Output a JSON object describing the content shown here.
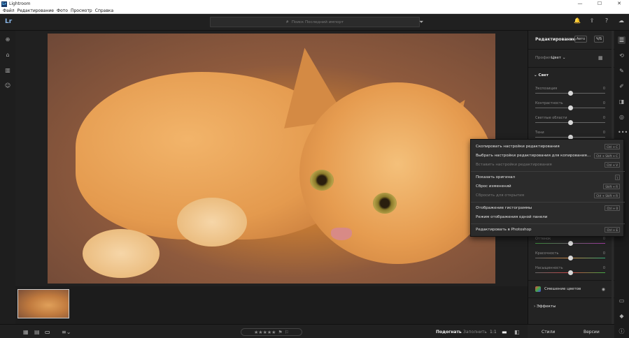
{
  "window": {
    "title": "Lightroom"
  },
  "menu": {
    "items": [
      "Файл",
      "Редактирование",
      "Фото",
      "Просмотр",
      "Справка"
    ]
  },
  "app": {
    "logo": "Lr"
  },
  "search": {
    "placeholder": "Поиск Последний импорт"
  },
  "edit_panel": {
    "title": "Редактирование",
    "auto": "Авто",
    "bw": "Ч/Б",
    "profile_label": "Профиль",
    "profile_value": "Цвет",
    "light_section": "Свет",
    "sliders": [
      {
        "label": "Экспозиция",
        "value": "0",
        "position": 0.5
      },
      {
        "label": "Контрастность",
        "value": "0",
        "position": 0.5
      },
      {
        "label": "Светлые области",
        "value": "0",
        "position": 0.5
      },
      {
        "label": "Тени",
        "value": "0",
        "position": 0.5
      }
    ],
    "color_sliders": [
      {
        "label": "Оттенок",
        "value": "0",
        "position": 0.5
      },
      {
        "label": "Красочность",
        "value": "0",
        "position": 0.5
      },
      {
        "label": "Насыщенность",
        "value": "0",
        "position": 0.5
      }
    ],
    "color_mix": "Смешение цветов",
    "effects": "Эффекты"
  },
  "bottom": {
    "fit": "Подогнать",
    "fill": "Заполнить",
    "one_to_one": "1:1",
    "presets": "Стили",
    "versions": "Версии",
    "stars": "★★★★★"
  },
  "context_menu": {
    "items": [
      {
        "label": "Скопировать настройки редактирования",
        "shortcut": "Ctrl + C",
        "disabled": false
      },
      {
        "label": "Выбрать настройки редактирования для копирования...",
        "shortcut": "Ctrl + Shift + C",
        "disabled": false
      },
      {
        "label": "Вставить настройки редактирования",
        "shortcut": "Ctrl + V",
        "disabled": true
      },
      {
        "label": "Показать оригинал",
        "shortcut": "\\",
        "disabled": false
      },
      {
        "label": "Сброс изменений",
        "shortcut": "Shift + R",
        "disabled": false
      },
      {
        "label": "Сбросить для открытия",
        "shortcut": "Ctrl + Shift + R",
        "disabled": true
      },
      {
        "label": "Отображение гистограммы",
        "shortcut": "Ctrl + 0",
        "disabled": false
      },
      {
        "label": "Режим отображения одной панели",
        "shortcut": "",
        "disabled": false
      },
      {
        "label": "Редактировать в Photoshop",
        "shortcut": "Ctrl + E",
        "disabled": false
      }
    ]
  }
}
